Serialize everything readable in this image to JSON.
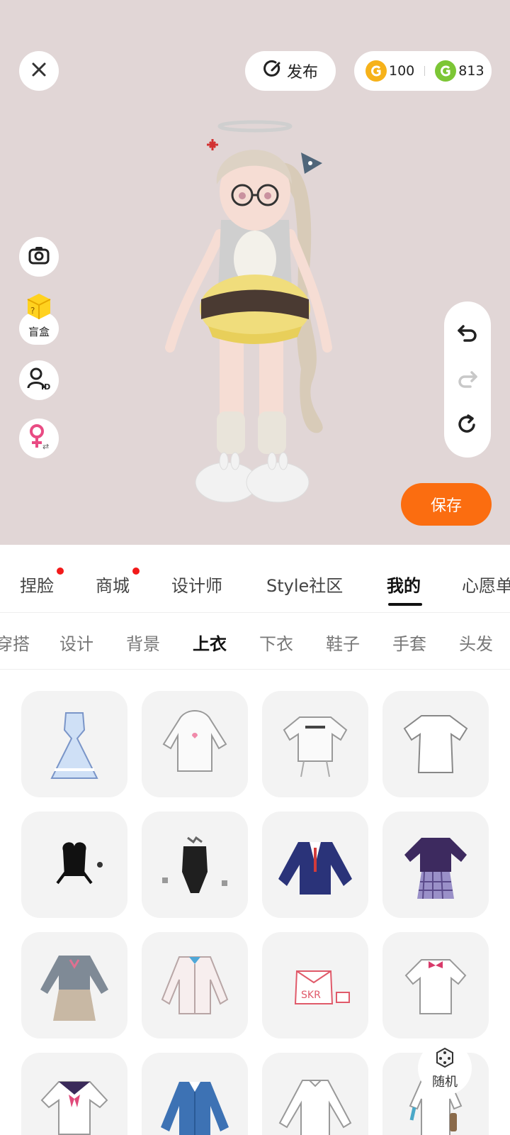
{
  "header": {
    "close_icon": "close-icon",
    "publish": {
      "icon": "publish-icon",
      "label": "发布"
    },
    "currency": [
      {
        "icon": "gold-coin-icon",
        "color": "#f6b21a",
        "amount": "100"
      },
      {
        "icon": "green-coin-icon",
        "color": "#7cc635",
        "amount": "813"
      }
    ]
  },
  "side_tools": {
    "camera_icon": "camera-icon",
    "blind_box": {
      "icon": "blind-box-icon",
      "label": "盲盒"
    },
    "avatar_id_icon": "avatar-id-icon",
    "gender_icon": "female-icon"
  },
  "history": {
    "undo_icon": "undo-icon",
    "redo_icon": "redo-icon",
    "reset_icon": "reset-icon"
  },
  "save_label": "保存",
  "category_tabs": [
    {
      "label": "捏脸",
      "dot": true
    },
    {
      "label": "商城",
      "dot": true
    },
    {
      "label": "设计师",
      "dot": false
    },
    {
      "label": "Style社区",
      "dot": false
    },
    {
      "label": "我的",
      "dot": false,
      "active": true
    },
    {
      "label": "心愿单",
      "dot": false
    }
  ],
  "sub_tabs": [
    {
      "label": "穿搭"
    },
    {
      "label": "设计"
    },
    {
      "label": "背景"
    },
    {
      "label": "上衣",
      "active": true
    },
    {
      "label": "下衣"
    },
    {
      "label": "鞋子"
    },
    {
      "label": "手套"
    },
    {
      "label": "头发"
    }
  ],
  "items": [
    {
      "icon": "light-blue-dress-icon"
    },
    {
      "icon": "white-hoodie-icon"
    },
    {
      "icon": "white-crop-tee-icon"
    },
    {
      "icon": "white-tshirt-icon"
    },
    {
      "icon": "black-bow-top-icon"
    },
    {
      "icon": "black-bodysuit-icon"
    },
    {
      "icon": "navy-blazer-icon"
    },
    {
      "icon": "purple-plaid-dress-icon"
    },
    {
      "icon": "gray-school-uniform-icon"
    },
    {
      "icon": "white-cardigan-icon"
    },
    {
      "icon": "pink-print-top-icon"
    },
    {
      "icon": "white-shirt-bow-icon"
    },
    {
      "icon": "sailor-top-icon"
    },
    {
      "icon": "blue-jacket-icon"
    },
    {
      "icon": "white-blouse-icon"
    },
    {
      "icon": "white-apron-top-icon"
    }
  ],
  "random_button": {
    "icon": "dice-icon",
    "label": "随机"
  },
  "colors": {
    "accent": "#fb6d10",
    "preview_bg": "#e1d6d6",
    "red_dot": "#f21a1a"
  }
}
